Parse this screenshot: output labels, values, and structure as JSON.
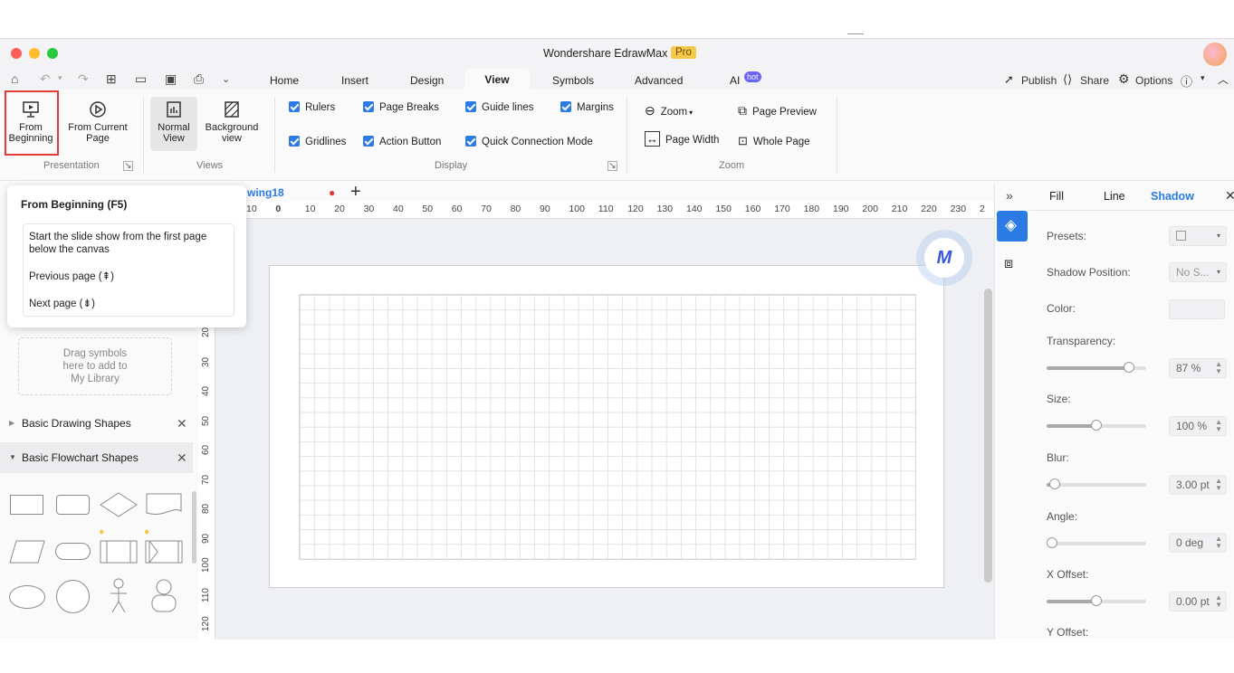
{
  "window": {
    "title": "Wondershare EdrawMax",
    "badge": "Pro"
  },
  "menu": {
    "tabs": [
      "Home",
      "Insert",
      "Design",
      "View",
      "Symbols",
      "Advanced",
      "AI"
    ],
    "active": "View",
    "ai_badge": "hot",
    "right": {
      "publish": "Publish",
      "share": "Share",
      "options": "Options"
    }
  },
  "ribbon": {
    "presentation": {
      "from_beginning": "From Beginning",
      "from_current": "From Current Page",
      "label": "Presentation"
    },
    "views": {
      "normal": "Normal View",
      "background": "Background view",
      "label": "Views"
    },
    "display": {
      "label": "Display",
      "checks": {
        "rulers": "Rulers",
        "page_breaks": "Page Breaks",
        "guide_lines": "Guide lines",
        "margins": "Margins",
        "gridlines": "Gridlines",
        "action_button": "Action Button",
        "quick_connection": "Quick Connection Mode"
      }
    },
    "zoom": {
      "zoom": "Zoom",
      "page_preview": "Page Preview",
      "page_width": "Page Width",
      "whole_page": "Whole Page",
      "label": "Zoom"
    }
  },
  "doc_tab": {
    "name": "wing18"
  },
  "tooltip": {
    "title": "From Beginning (F5)",
    "desc": "Start the slide show from the first page below the canvas",
    "prev": "Previous page (⇞)",
    "next": "Next page (⇟)"
  },
  "library": {
    "drop_hint_1": "Drag symbols",
    "drop_hint_2": "here to add to",
    "drop_hint_3": "My Library",
    "section_basic": "Basic Drawing Shapes",
    "section_flowchart": "Basic Flowchart Shapes"
  },
  "ruler_h": [
    "10",
    "0",
    "10",
    "20",
    "30",
    "40",
    "50",
    "60",
    "70",
    "80",
    "90",
    "100",
    "110",
    "120",
    "130",
    "140",
    "150",
    "160",
    "170",
    "180",
    "190",
    "200",
    "210",
    "220",
    "230",
    "2"
  ],
  "ruler_v": [
    "20",
    "30",
    "40",
    "50",
    "60",
    "70",
    "80",
    "90",
    "100",
    "110",
    "120"
  ],
  "panel": {
    "tabs": {
      "fill": "Fill",
      "line": "Line",
      "shadow": "Shadow"
    },
    "presets": "Presets:",
    "shadow_position": "Shadow Position:",
    "shadow_position_value": "No S...",
    "color": "Color:",
    "transparency": "Transparency:",
    "transparency_value": "87 %",
    "size": "Size:",
    "size_value": "100 %",
    "blur": "Blur:",
    "blur_value": "3.00 pt",
    "angle": "Angle:",
    "angle_value": "0 deg",
    "x_offset": "X Offset:",
    "x_offset_value": "0.00 pt",
    "y_offset": "Y Offset:",
    "sliders": {
      "transparency": 0.87,
      "size": 0.5,
      "blur": 0.03,
      "angle": 0.0,
      "x_offset": 0.5
    }
  },
  "colors": {
    "accent": "#2c7be5",
    "highlight": "#e53935",
    "pro_badge": "#f7c94b",
    "hot_badge": "#6b63f7"
  }
}
